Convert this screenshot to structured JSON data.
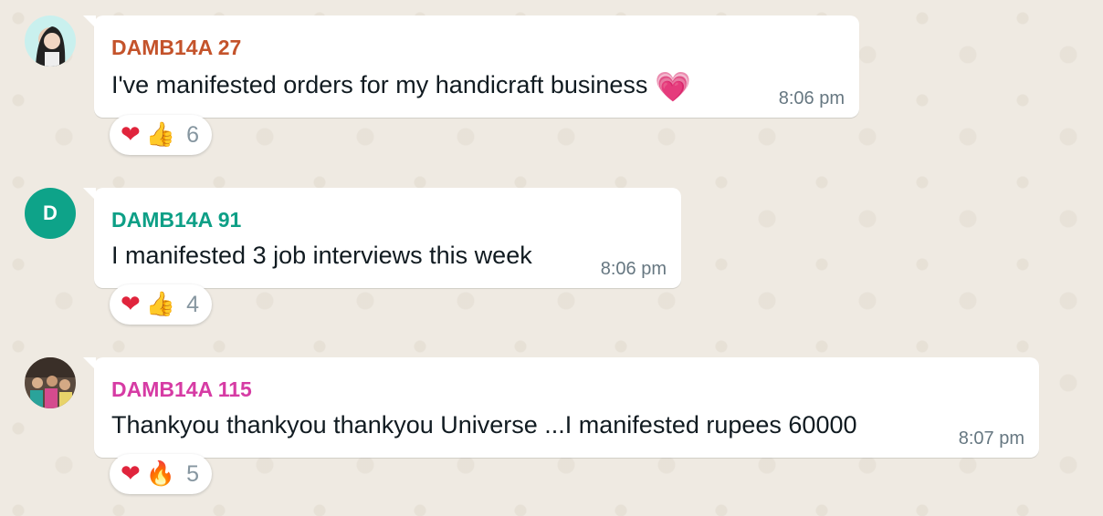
{
  "messages": [
    {
      "sender": "DAMB14A 27",
      "sender_color": "#c4532b",
      "text": "I've manifested orders for my  handicraft business",
      "inline_emoji": "💗",
      "time": "8:06 pm",
      "reactions": {
        "emoji_1": "❤",
        "emoji_2": "👍",
        "count": "6"
      }
    },
    {
      "sender": "DAMB14A 91",
      "sender_color": "#0d9f86",
      "avatar_letter": "D",
      "text": "I manifested 3 job interviews this week",
      "time": "8:06 pm",
      "reactions": {
        "emoji_1": "❤",
        "emoji_2": "👍",
        "count": "4"
      }
    },
    {
      "sender": "DAMB14A 115",
      "sender_color": "#d63ba4",
      "text": "Thankyou thankyou  thankyou Universe ...I manifested rupees 60000",
      "time": "8:07 pm",
      "reactions": {
        "emoji_1": "❤",
        "emoji_2": "🔥",
        "count": "5"
      }
    }
  ]
}
